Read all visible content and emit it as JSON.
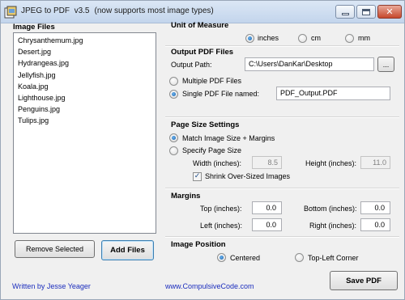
{
  "window": {
    "app_name": "JPEG to PDF  v3.5",
    "subtitle": "(now supports most image types)"
  },
  "image_files": {
    "heading": "Image Files",
    "items": [
      "Chrysanthemum.jpg",
      "Desert.jpg",
      "Hydrangeas.jpg",
      "Jellyfish.jpg",
      "Koala.jpg",
      "Lighthouse.jpg",
      "Penguins.jpg",
      "Tulips.jpg"
    ],
    "remove_label": "Remove Selected",
    "add_label": "Add Files"
  },
  "unit": {
    "heading": "Unit of Measure",
    "options": [
      "inches",
      "cm",
      "mm"
    ],
    "selected": "inches"
  },
  "output": {
    "heading": "Output PDF Files",
    "path_label": "Output Path:",
    "path_value": "C:\\Users\\DanKar\\Desktop",
    "browse_label": "...",
    "multiple_label": "Multiple PDF Files",
    "single_label": "Single PDF File named:",
    "single_value": "PDF_Output.PDF",
    "selected": "single"
  },
  "page_size": {
    "heading": "Page Size Settings",
    "match_label": "Match Image Size + Margins",
    "specify_label": "Specify Page Size",
    "width_label": "Width (inches):",
    "width_value": "8.5",
    "height_label": "Height (inches):",
    "height_value": "11.0",
    "shrink_label": "Shrink Over-Sized Images",
    "shrink_checked": true,
    "selected": "match"
  },
  "margins": {
    "heading": "Margins",
    "top_label": "Top (inches):",
    "top_value": "0.0",
    "bottom_label": "Bottom (inches):",
    "bottom_value": "0.0",
    "left_label": "Left (inches):",
    "left_value": "0.0",
    "right_label": "Right (inches):",
    "right_value": "0.0"
  },
  "position": {
    "heading": "Image Position",
    "centered_label": "Centered",
    "topleft_label": "Top-Left Corner",
    "selected": "centered"
  },
  "footer": {
    "author": "Written by Jesse Yeager",
    "website": "www.CompulsiveCode.com",
    "save_label": "Save PDF"
  },
  "colors": {
    "link": "#1b2dbd",
    "radio_dot": "#1a5fa8",
    "window_bg": "#f0f0f0"
  }
}
